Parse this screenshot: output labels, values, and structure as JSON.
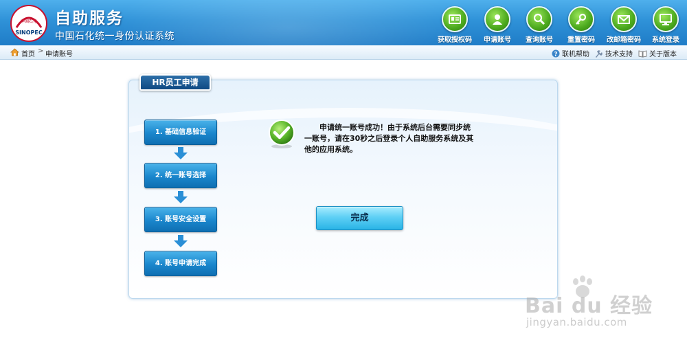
{
  "header": {
    "logo_text": "中国石化 SINOPEC",
    "title": "自助服务",
    "subtitle": "中国石化统一身份认证系统",
    "nav": [
      {
        "label": "获取授权码",
        "icon": "id-card-icon"
      },
      {
        "label": "申请账号",
        "icon": "user-icon"
      },
      {
        "label": "查询账号",
        "icon": "magnifier-icon"
      },
      {
        "label": "重置密码",
        "icon": "key-icon"
      },
      {
        "label": "改邮箱密码",
        "icon": "envelope-icon"
      },
      {
        "label": "系统登录",
        "icon": "monitor-icon"
      }
    ]
  },
  "breadcrumb": {
    "home": "首页",
    "separator": ">",
    "current": "申请账号"
  },
  "toolbar": {
    "help": "联机帮助",
    "support": "技术支持",
    "about": "关于版本"
  },
  "panel": {
    "tab_title": "HR员工申请",
    "steps": [
      "1. 基础信息验证",
      "2. 统一账号选择",
      "3. 账号安全设置",
      "4. 账号申请完成"
    ],
    "message": "申请统一账号成功！由于系统后台需要同步统一账号，请在30秒之后登录个人自助服务系统及其他的应用系统。",
    "done_label": "完成"
  },
  "watermark": {
    "text": "Bai du 经验",
    "url": "jingyan.baidu.com"
  },
  "colors": {
    "header_blue": "#2f92d8",
    "step_blue": "#1a86cc",
    "done_cyan": "#5fd0f5",
    "ok_green": "#5ab52a"
  }
}
